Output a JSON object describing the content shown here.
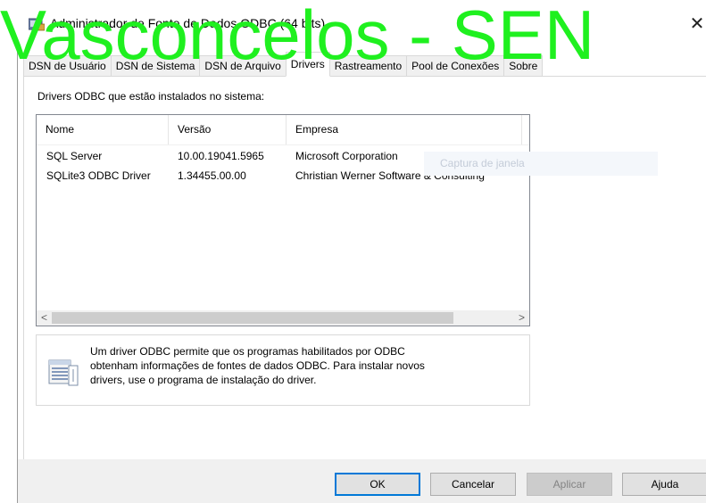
{
  "window": {
    "title": "Administrador de Fonte de Dados ODBC (64 bits)",
    "close_glyph": "✕",
    "icon": "odbc-admin-icon"
  },
  "watermark": "Vasconcelos - SEN",
  "tabs": [
    {
      "label": "DSN de Usuário",
      "active": false
    },
    {
      "label": "DSN de Sistema",
      "active": false
    },
    {
      "label": "DSN de Arquivo",
      "active": false
    },
    {
      "label": "Drivers",
      "active": true
    },
    {
      "label": "Rastreamento",
      "active": false
    },
    {
      "label": "Pool de Conexões",
      "active": false
    },
    {
      "label": "Sobre",
      "active": false
    }
  ],
  "drivers_panel": {
    "label": "Drivers ODBC que estão instalados no sistema:",
    "columns": [
      "Nome",
      "Versão",
      "Empresa"
    ],
    "rows": [
      {
        "name": "SQL Server",
        "version": "10.00.19041.5965",
        "company": "Microsoft Corporation"
      },
      {
        "name": "SQLite3 ODBC Driver",
        "version": "1.34455.00.00",
        "company": "Christian Werner Software & Consulting"
      }
    ],
    "scroll_left": "<",
    "scroll_right": ">"
  },
  "info": {
    "lines": [
      "Um driver ODBC permite que os programas habilitados por ODBC",
      "obtenham informações de fontes de dados ODBC. Para instalar novos",
      "drivers, use o programa de instalação do driver."
    ],
    "icon": "database-info-icon"
  },
  "ghost_overlay": "Captura de janela",
  "buttons": {
    "ok": "OK",
    "cancel": "Cancelar",
    "apply": "Aplicar",
    "help": "Ajuda"
  },
  "colors": {
    "watermark": "#1ff01f",
    "default_button_border": "#0078d7"
  }
}
